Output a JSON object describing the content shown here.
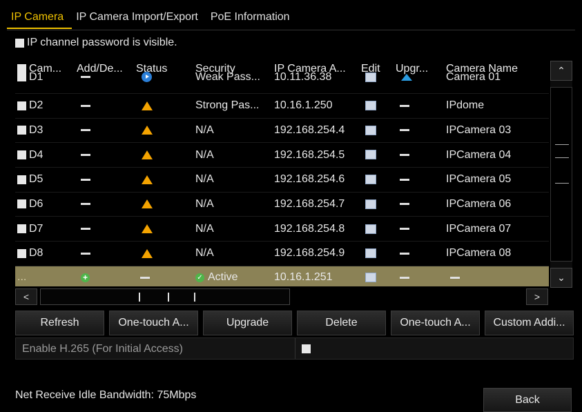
{
  "tabs": [
    "IP Camera",
    "IP Camera Import/Export",
    "PoE Information"
  ],
  "password_visible_label": "IP channel password is visible.",
  "table": {
    "headers": [
      "Cam...",
      "Add/De...",
      "Status",
      "Security",
      "IP Camera A...",
      "Edit",
      "Upgr...",
      "Camera Name"
    ],
    "rows": [
      {
        "cam": "D1",
        "status": "play",
        "security": "Weak Pass...",
        "ip": "10.11.36.38",
        "upgrade": "upgrade",
        "name": "Camera 01"
      },
      {
        "cam": "D2",
        "status": "warning",
        "security": "Strong Pas...",
        "ip": "10.16.1.250",
        "upgrade": "dash",
        "name": "IPdome"
      },
      {
        "cam": "D3",
        "status": "warning",
        "security": "N/A",
        "ip": "192.168.254.4",
        "upgrade": "dash",
        "name": "IPCamera 03"
      },
      {
        "cam": "D4",
        "status": "warning",
        "security": "N/A",
        "ip": "192.168.254.5",
        "upgrade": "dash",
        "name": "IPCamera 04"
      },
      {
        "cam": "D5",
        "status": "warning",
        "security": "N/A",
        "ip": "192.168.254.6",
        "upgrade": "dash",
        "name": "IPCamera 05"
      },
      {
        "cam": "D6",
        "status": "warning",
        "security": "N/A",
        "ip": "192.168.254.7",
        "upgrade": "dash",
        "name": "IPCamera 06"
      },
      {
        "cam": "D7",
        "status": "warning",
        "security": "N/A",
        "ip": "192.168.254.8",
        "upgrade": "dash",
        "name": "IPCamera 07"
      },
      {
        "cam": "D8",
        "status": "warning",
        "security": "N/A",
        "ip": "192.168.254.9",
        "upgrade": "dash",
        "name": "IPCamera 08"
      }
    ],
    "online_row": {
      "cam": "...",
      "security": "Active",
      "ip": "10.16.1.251"
    }
  },
  "buttons": {
    "refresh": "Refresh",
    "one_touch_activate": "One-touch A...",
    "upgrade": "Upgrade",
    "delete": "Delete",
    "one_touch_adding": "One-touch A...",
    "custom_adding": "Custom Addi..."
  },
  "h265_label": "Enable H.265 (For Initial Access)",
  "bandwidth": "Net Receive Idle Bandwidth: 75Mbps",
  "back": "Back",
  "scroll": {
    "up": "^",
    "down": "v",
    "left": "<",
    "right": ">"
  },
  "colors": {
    "active_tab": "#f0c200",
    "selected_row": "#8b8256",
    "warning": "#f4a300"
  }
}
